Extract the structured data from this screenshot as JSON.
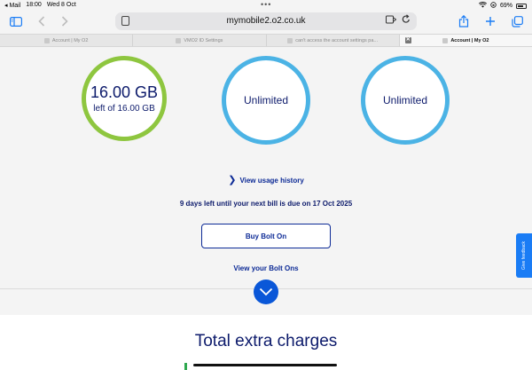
{
  "status_bar": {
    "back_app": "◂ Mail",
    "time": "18:00",
    "date": "Wed 8 Oct",
    "dots": "•••",
    "battery_percent": "69%"
  },
  "browser": {
    "url": "mymobile2.o2.co.uk",
    "tabs": [
      {
        "title": "Account | My O2",
        "active": false
      },
      {
        "title": "VMO2 ID Settings",
        "active": false
      },
      {
        "title": "can't access the account settings pa...",
        "active": false
      },
      {
        "title": "Account | My O2",
        "active": true
      }
    ]
  },
  "allowances": {
    "data": {
      "value": "16.00 GB",
      "caption": "left of 16.00 GB"
    },
    "minutes": {
      "value": "Unlimited"
    },
    "texts": {
      "value": "Unlimited"
    }
  },
  "links": {
    "usage_history": "View usage history",
    "bill_info": "9 days left until your next bill is due on 17 Oct 2025",
    "buy_bolt_on": "Buy Bolt On",
    "view_bolt_ons": "View your Bolt Ons"
  },
  "sections": {
    "extra_charges_title": "Total extra charges"
  },
  "feedback": {
    "label": "Give feedback"
  },
  "colors": {
    "data_ring": "#8ec63f",
    "unlimited_ring": "#4bb3e5",
    "o2_navy": "#0c1a6b",
    "o2_blue": "#0a57d8",
    "safari_blue": "#1a7cf5"
  }
}
